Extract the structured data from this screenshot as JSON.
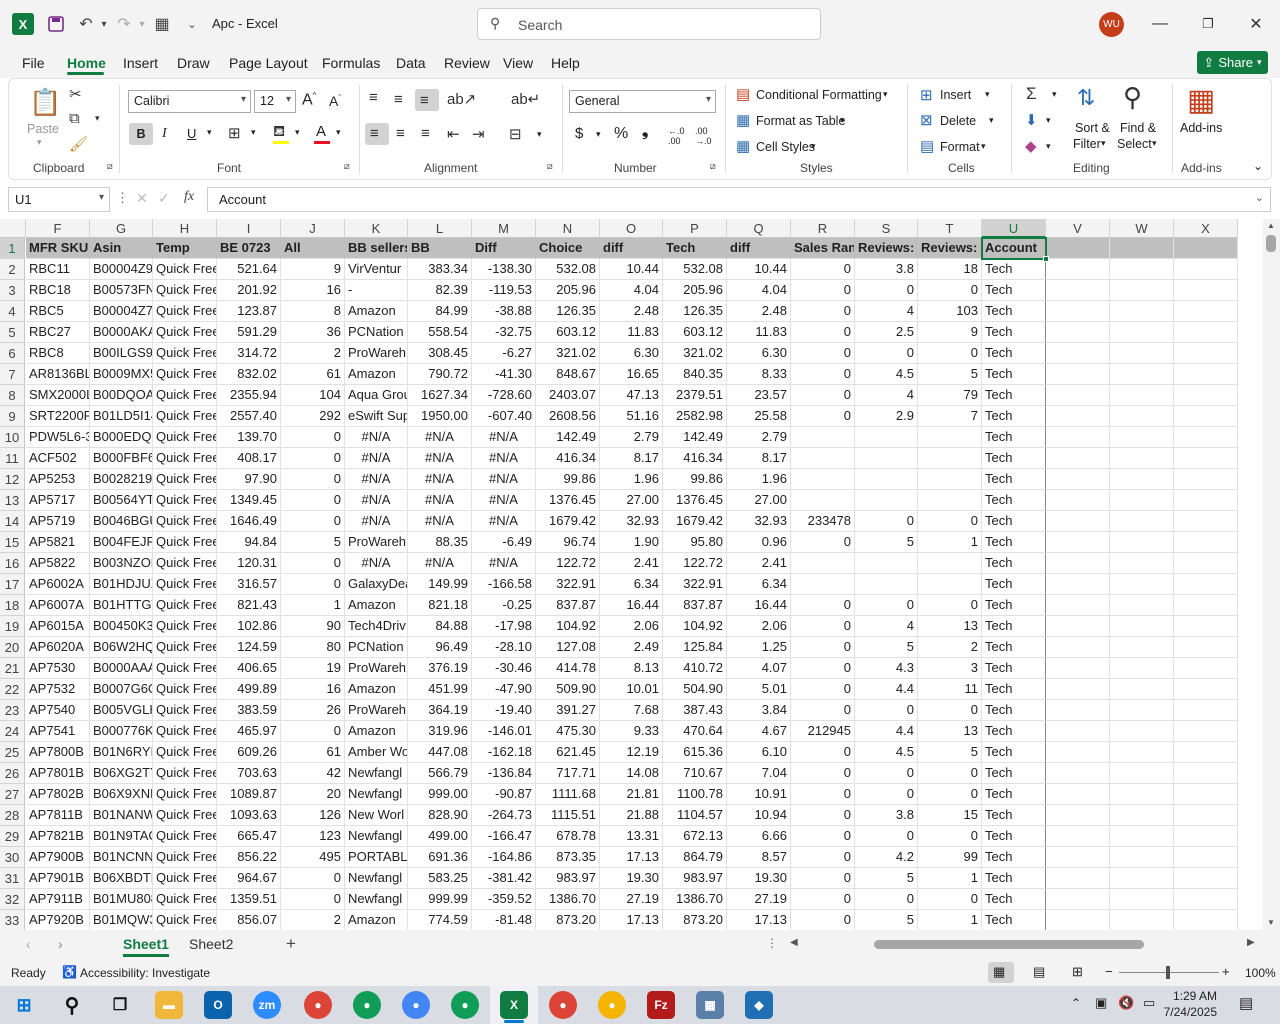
{
  "app": {
    "title": "Apc - Excel",
    "search_placeholder": "Search",
    "user_initials": "WU",
    "share_label": "Share"
  },
  "menu": [
    "File",
    "Home",
    "Insert",
    "Draw",
    "Page Layout",
    "Formulas",
    "Data",
    "Review",
    "View",
    "Help"
  ],
  "ribbon": {
    "clipboard": {
      "paste": "Paste",
      "label": "Clipboard"
    },
    "font": {
      "name": "Calibri",
      "size": "12",
      "label": "Font"
    },
    "alignment": {
      "label": "Alignment"
    },
    "number": {
      "format": "General",
      "label": "Number"
    },
    "styles": {
      "conditional": "Conditional Formatting",
      "table": "Format as Table",
      "cell_styles": "Cell Styles",
      "label": "Styles"
    },
    "cells": {
      "insert": "Insert",
      "delete": "Delete",
      "format": "Format",
      "label": "Cells"
    },
    "editing": {
      "sort1": "Sort &",
      "sort2": "Filter",
      "find1": "Find &",
      "find2": "Select",
      "label": "Editing"
    },
    "addins": {
      "btn": "Add-ins",
      "label": "Add-ins"
    }
  },
  "formula_bar": {
    "name_box": "U1",
    "fx": "fx",
    "content": "Account"
  },
  "columns": [
    "F",
    "G",
    "H",
    "I",
    "J",
    "K",
    "L",
    "M",
    "N",
    "O",
    "P",
    "Q",
    "R",
    "S",
    "T",
    "U",
    "V",
    "W",
    "X"
  ],
  "header_row": [
    "MFR SKU",
    "Asin",
    "Temp",
    "BE 0723",
    "All",
    "BB sellers",
    "BB",
    "Diff",
    "Choice",
    "diff",
    "Tech",
    "diff",
    "Sales Rank",
    "Reviews:",
    "Reviews:",
    "Account"
  ],
  "rows": [
    [
      "RBC11",
      "B00004Z95",
      "Quick Free",
      "521.64",
      "9",
      "VirVentur",
      "383.34",
      "-138.30",
      "532.08",
      "10.44",
      "532.08",
      "10.44",
      "0",
      "3.8",
      "18",
      "Tech"
    ],
    [
      "RBC18",
      "B00573FN",
      "Quick Free",
      "201.92",
      "16",
      "-",
      "82.39",
      "-119.53",
      "205.96",
      "4.04",
      "205.96",
      "4.04",
      "0",
      "0",
      "0",
      "Tech"
    ],
    [
      "RBC5",
      "B00004Z70",
      "Quick Free",
      "123.87",
      "8",
      "Amazon",
      "84.99",
      "-38.88",
      "126.35",
      "2.48",
      "126.35",
      "2.48",
      "0",
      "4",
      "103",
      "Tech"
    ],
    [
      "RBC27",
      "B0000AKA",
      "Quick Free",
      "591.29",
      "36",
      "PCNation",
      "558.54",
      "-32.75",
      "603.12",
      "11.83",
      "603.12",
      "11.83",
      "0",
      "2.5",
      "9",
      "Tech"
    ],
    [
      "RBC8",
      "B00ILGS9F",
      "Quick Free",
      "314.72",
      "2",
      "ProWareh",
      "308.45",
      "-6.27",
      "321.02",
      "6.30",
      "321.02",
      "6.30",
      "0",
      "0",
      "0",
      "Tech"
    ],
    [
      "AR8136BL",
      "B0009MX5",
      "Quick Free",
      "832.02",
      "61",
      "Amazon",
      "790.72",
      "-41.30",
      "848.67",
      "16.65",
      "840.35",
      "8.33",
      "0",
      "4.5",
      "5",
      "Tech"
    ],
    [
      "SMX2000L",
      "B00DQOA",
      "Quick Free",
      "2355.94",
      "104",
      "Aqua Grou",
      "1627.34",
      "-728.60",
      "2403.07",
      "47.13",
      "2379.51",
      "23.57",
      "0",
      "4",
      "79",
      "Tech"
    ],
    [
      "SRT2200RI",
      "B01LD5I14",
      "Quick Free",
      "2557.40",
      "292",
      "eSwift Sup",
      "1950.00",
      "-607.40",
      "2608.56",
      "51.16",
      "2582.98",
      "25.58",
      "0",
      "2.9",
      "7",
      "Tech"
    ],
    [
      "PDW5L6-3",
      "B000EDQK",
      "Quick Free",
      "139.70",
      "0",
      "#N/A",
      "#N/A",
      "#N/A",
      "142.49",
      "2.79",
      "142.49",
      "2.79",
      "",
      "",
      "",
      "Tech"
    ],
    [
      "ACF502",
      "B000FBF6I",
      "Quick Free",
      "408.17",
      "0",
      "#N/A",
      "#N/A",
      "#N/A",
      "416.34",
      "8.17",
      "416.34",
      "8.17",
      "",
      "",
      "",
      "Tech"
    ],
    [
      "AP5253",
      "B0028219",
      "Quick Free",
      "97.90",
      "0",
      "#N/A",
      "#N/A",
      "#N/A",
      "99.86",
      "1.96",
      "99.86",
      "1.96",
      "",
      "",
      "",
      "Tech"
    ],
    [
      "AP5717",
      "B00564YT4",
      "Quick Free",
      "1349.45",
      "0",
      "#N/A",
      "#N/A",
      "#N/A",
      "1376.45",
      "27.00",
      "1376.45",
      "27.00",
      "",
      "",
      "",
      "Tech"
    ],
    [
      "AP5719",
      "B0046BGU",
      "Quick Free",
      "1646.49",
      "0",
      "#N/A",
      "#N/A",
      "#N/A",
      "1679.42",
      "32.93",
      "1679.42",
      "32.93",
      "233478",
      "0",
      "0",
      "Tech"
    ],
    [
      "AP5821",
      "B004FEJR6",
      "Quick Free",
      "94.84",
      "5",
      "ProWareh",
      "88.35",
      "-6.49",
      "96.74",
      "1.90",
      "95.80",
      "0.96",
      "0",
      "5",
      "1",
      "Tech"
    ],
    [
      "AP5822",
      "B003NZON",
      "Quick Free",
      "120.31",
      "0",
      "#N/A",
      "#N/A",
      "#N/A",
      "122.72",
      "2.41",
      "122.72",
      "2.41",
      "",
      "",
      "",
      "Tech"
    ],
    [
      "AP6002A",
      "B01HDJUX",
      "Quick Free",
      "316.57",
      "0",
      "GalaxyDea",
      "149.99",
      "-166.58",
      "322.91",
      "6.34",
      "322.91",
      "6.34",
      "",
      "",
      "",
      "Tech"
    ],
    [
      "AP6007A",
      "B01HTTGV",
      "Quick Free",
      "821.43",
      "1",
      "Amazon",
      "821.18",
      "-0.25",
      "837.87",
      "16.44",
      "837.87",
      "16.44",
      "0",
      "0",
      "0",
      "Tech"
    ],
    [
      "AP6015A",
      "B00450K34",
      "Quick Free",
      "102.86",
      "90",
      "Tech4Driv",
      "84.88",
      "-17.98",
      "104.92",
      "2.06",
      "104.92",
      "2.06",
      "0",
      "4",
      "13",
      "Tech"
    ],
    [
      "AP6020A",
      "B06W2HQ",
      "Quick Free",
      "124.59",
      "80",
      "PCNation",
      "96.49",
      "-28.10",
      "127.08",
      "2.49",
      "125.84",
      "1.25",
      "0",
      "5",
      "2",
      "Tech"
    ],
    [
      "AP7530",
      "B0000AAA",
      "Quick Free",
      "406.65",
      "19",
      "ProWareh",
      "376.19",
      "-30.46",
      "414.78",
      "8.13",
      "410.72",
      "4.07",
      "0",
      "4.3",
      "3",
      "Tech"
    ],
    [
      "AP7532",
      "B0007G6O",
      "Quick Free",
      "499.89",
      "16",
      "Amazon",
      "451.99",
      "-47.90",
      "509.90",
      "10.01",
      "504.90",
      "5.01",
      "0",
      "4.4",
      "11",
      "Tech"
    ],
    [
      "AP7540",
      "B005VGLH",
      "Quick Free",
      "383.59",
      "26",
      "ProWareh",
      "364.19",
      "-19.40",
      "391.27",
      "7.68",
      "387.43",
      "3.84",
      "0",
      "0",
      "0",
      "Tech"
    ],
    [
      "AP7541",
      "B000776K9",
      "Quick Free",
      "465.97",
      "0",
      "Amazon",
      "319.96",
      "-146.01",
      "475.30",
      "9.33",
      "470.64",
      "4.67",
      "212945",
      "4.4",
      "13",
      "Tech"
    ],
    [
      "AP7800B",
      "B01N6RYB",
      "Quick Free",
      "609.26",
      "61",
      "Amber Wo",
      "447.08",
      "-162.18",
      "621.45",
      "12.19",
      "615.36",
      "6.10",
      "0",
      "4.5",
      "5",
      "Tech"
    ],
    [
      "AP7801B",
      "B06XG2TY",
      "Quick Free",
      "703.63",
      "42",
      "Newfangl",
      "566.79",
      "-136.84",
      "717.71",
      "14.08",
      "710.67",
      "7.04",
      "0",
      "0",
      "0",
      "Tech"
    ],
    [
      "AP7802B",
      "B06X9XNF",
      "Quick Free",
      "1089.87",
      "20",
      "Newfangl",
      "999.00",
      "-90.87",
      "1111.68",
      "21.81",
      "1100.78",
      "10.91",
      "0",
      "0",
      "0",
      "Tech"
    ],
    [
      "AP7811B",
      "B01NANW",
      "Quick Free",
      "1093.63",
      "126",
      "New Worl",
      "828.90",
      "-264.73",
      "1115.51",
      "21.88",
      "1104.57",
      "10.94",
      "0",
      "3.8",
      "15",
      "Tech"
    ],
    [
      "AP7821B",
      "B01N9TAC",
      "Quick Free",
      "665.47",
      "123",
      "Newfangl",
      "499.00",
      "-166.47",
      "678.78",
      "13.31",
      "672.13",
      "6.66",
      "0",
      "0",
      "0",
      "Tech"
    ],
    [
      "AP7900B",
      "B01NCNN",
      "Quick Free",
      "856.22",
      "495",
      "PORTABLE",
      "691.36",
      "-164.86",
      "873.35",
      "17.13",
      "864.79",
      "8.57",
      "0",
      "4.2",
      "99",
      "Tech"
    ],
    [
      "AP7901B",
      "B06XBDTF",
      "Quick Free",
      "964.67",
      "0",
      "Newfangl",
      "583.25",
      "-381.42",
      "983.97",
      "19.30",
      "983.97",
      "19.30",
      "0",
      "5",
      "1",
      "Tech"
    ],
    [
      "AP7911B",
      "B01MU808",
      "Quick Free",
      "1359.51",
      "0",
      "Newfangl",
      "999.99",
      "-359.52",
      "1386.70",
      "27.19",
      "1386.70",
      "27.19",
      "0",
      "0",
      "0",
      "Tech"
    ],
    [
      "AP7920B",
      "B01MQW3",
      "Quick Free",
      "856.07",
      "2",
      "Amazon",
      "774.59",
      "-81.48",
      "873.20",
      "17.13",
      "873.20",
      "17.13",
      "0",
      "5",
      "1",
      "Tech"
    ]
  ],
  "sheets": [
    "Sheet1",
    "Sheet2"
  ],
  "status": {
    "ready": "Ready",
    "accessibility": "Accessibility: Investigate",
    "zoom": "100%"
  },
  "taskbar": {
    "time": "1:29 AM",
    "date": "7/24/2025"
  },
  "colors": {
    "excel_green": "#107c41",
    "header_fill": "#bfbfbf",
    "avatar": "#c43e1c"
  }
}
